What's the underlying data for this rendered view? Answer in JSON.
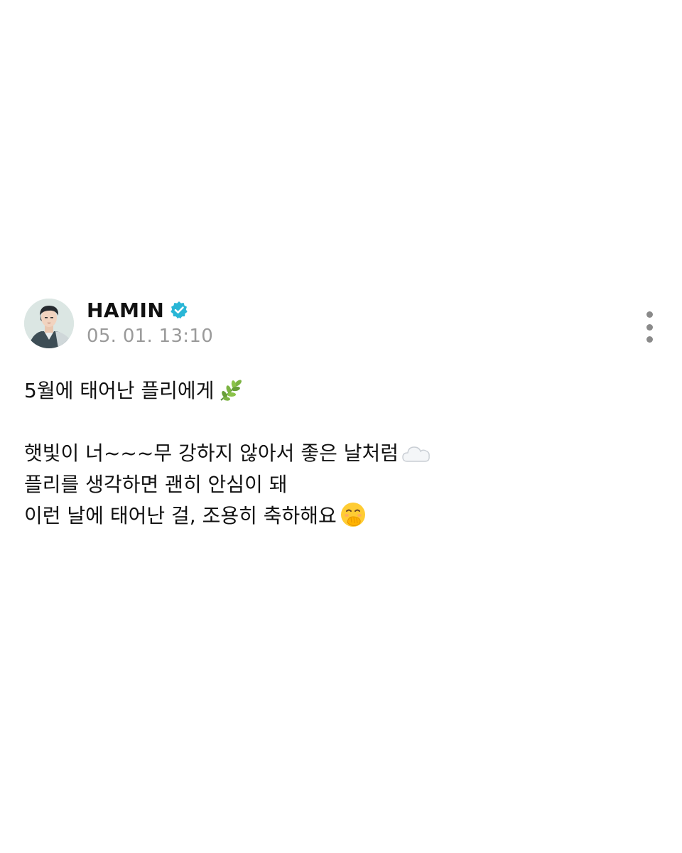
{
  "post": {
    "author": {
      "name": "HAMIN",
      "verified": true,
      "avatar_icon": "avatar-illustration"
    },
    "timestamp": "05. 01. 13:10",
    "more_icon": "more-vertical-icon",
    "body": {
      "line1": "5월에 태어난 플리에게",
      "line1_emoji": "herb-icon",
      "line2": "햇빛이 너~~~무 강하지 않아서 좋은 날처럼",
      "line2_emoji": "cloud-icon",
      "line3": "플리를 생각하면 괜히 안심이 돼",
      "line4": "이런 날에 태어난 걸, 조용히 축하해요",
      "line4_emoji": "face-with-hand-over-mouth-icon"
    }
  },
  "colors": {
    "verified_badge": "#29b6d6",
    "timestamp": "#9a9a9a",
    "text": "#111111"
  }
}
